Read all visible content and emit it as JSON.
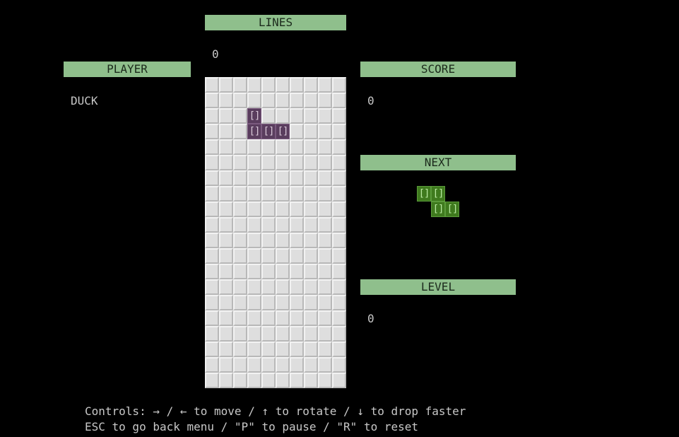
{
  "lines": {
    "label": "LINES",
    "value": "0"
  },
  "player": {
    "label": "PLAYER",
    "value": "DUCK"
  },
  "score": {
    "label": "SCORE",
    "value": "0"
  },
  "next": {
    "label": "NEXT"
  },
  "level": {
    "label": "LEVEL",
    "value": "0"
  },
  "board": {
    "cols": 10,
    "rows": 20,
    "block_glyph": "[]",
    "active_piece": {
      "color": "#5a3d5e",
      "text_color": "#d8c8d8",
      "border_color": "#7a5a7e",
      "cells": [
        [
          3,
          2
        ],
        [
          3,
          3
        ],
        [
          4,
          3
        ],
        [
          5,
          3
        ]
      ]
    }
  },
  "next_piece": {
    "color": "#3f7a1e",
    "text_color": "#b8e8a0",
    "border_color": "#5a9a3a",
    "cells": [
      [
        0,
        0
      ],
      [
        1,
        0
      ],
      [
        1,
        1
      ],
      [
        2,
        1
      ]
    ]
  },
  "controls": {
    "line1": "Controls: → / ← to move / ↑ to rotate / ↓ to drop faster",
    "line2": "ESC to go back menu / \"P\" to pause / \"R\" to reset"
  }
}
